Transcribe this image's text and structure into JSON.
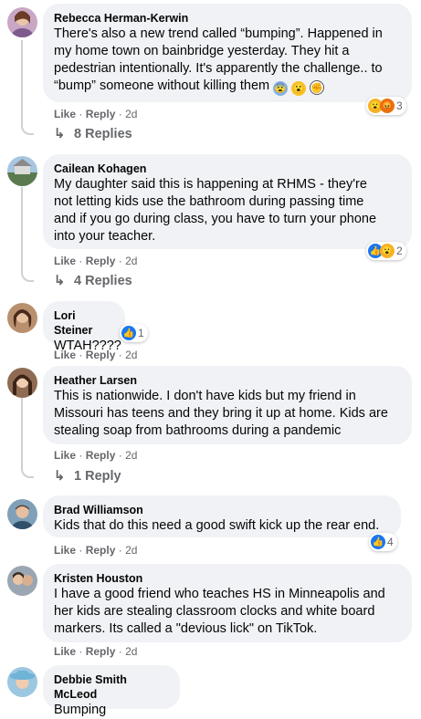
{
  "comments": [
    {
      "author": "Rebecca Herman-Kerwin",
      "lines": [
        "There's also a new trend called “bumping”. Happened in",
        "my home town on bainbridge yesterday. They hit a",
        "pedestrian intentionally. It's apparently the challenge.. to",
        "“bump” someone without killing them"
      ],
      "emojis": [
        "fearful-emoji",
        "surprised-emoji",
        "fist-emoji"
      ],
      "like": "Like",
      "reply": "Reply",
      "time": "2d",
      "reaction_count": "3",
      "replies": "8 Replies"
    },
    {
      "author": "Cailean Kohagen",
      "lines": [
        "My daughter said this is happening at RHMS - they're",
        "not letting kids use the bathroom during passing time",
        "and if you go during class, you have to turn your phone",
        "into your teacher."
      ],
      "like": "Like",
      "reply": "Reply",
      "time": "2d",
      "reaction_count": "2",
      "replies": "4 Replies"
    },
    {
      "author": "Lori Steiner",
      "lines": [
        "WTAH????"
      ],
      "like": "Like",
      "reply": "Reply",
      "time": "2d",
      "reaction_count": "1"
    },
    {
      "author": "Heather Larsen",
      "lines": [
        "This is nationwide. I don't have kids but my friend in",
        "Missouri has teens and they bring it up at home. Kids are",
        "stealing soap from bathrooms during a pandemic"
      ],
      "like": "Like",
      "reply": "Reply",
      "time": "2d",
      "replies": "1 Reply"
    },
    {
      "author": "Brad Williamson",
      "lines": [
        "Kids that do this need a good swift kick up the rear end."
      ],
      "like": "Like",
      "reply": "Reply",
      "time": "2d",
      "reaction_count": "4"
    },
    {
      "author": "Kristen Houston",
      "lines": [
        "I have a good friend who teaches HS in Minneapolis and",
        "her kids are stealing classroom clocks and white board",
        "markers. Its called a \"devious lick\" on TikTok."
      ],
      "like": "Like",
      "reply": "Reply",
      "time": "2d"
    },
    {
      "author": "Debbie Smith McLeod",
      "lines": [
        "Bumping"
      ]
    }
  ],
  "ui": {
    "dot": "·",
    "reply_arrow": "↳"
  },
  "colors": {
    "bubble": "#f0f2f5",
    "meta": "#65676b",
    "like_blue": "#1877f2",
    "thread_line": "#ced0d4"
  }
}
